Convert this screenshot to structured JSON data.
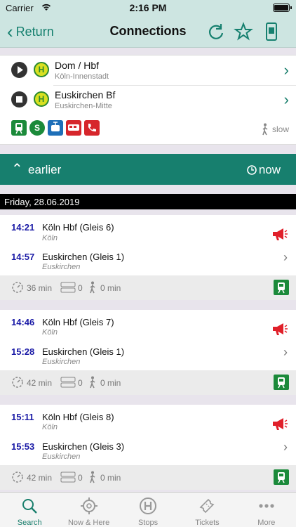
{
  "status": {
    "carrier": "Carrier",
    "time": "2:16 PM"
  },
  "nav": {
    "back_label": "Return",
    "title": "Connections"
  },
  "request": {
    "origin": {
      "name": "Dom / Hbf",
      "sub": "Köln-Innenstadt"
    },
    "destination": {
      "name": "Euskirchen Bf",
      "sub": "Euskirchen-Mitte"
    },
    "transport_modes": [
      "regional-train-icon",
      "s-bahn-icon",
      "tram-icon",
      "bus-icon",
      "phone-taxi-icon"
    ],
    "walk_speed": "slow"
  },
  "earlier": {
    "label": "earlier",
    "now_label": "now"
  },
  "date_header": "Friday, 28.06.2019",
  "connections": [
    {
      "dep_time": "14:21",
      "dep_station": "Köln Hbf (Gleis 6)",
      "dep_city": "Köln",
      "arr_time": "14:57",
      "arr_station": "Euskirchen (Gleis 1)",
      "arr_city": "Euskirchen",
      "duration": "36 min",
      "changes": "0",
      "walk": "0 min"
    },
    {
      "dep_time": "14:46",
      "dep_station": "Köln Hbf (Gleis 7)",
      "dep_city": "Köln",
      "arr_time": "15:28",
      "arr_station": "Euskirchen (Gleis 1)",
      "arr_city": "Euskirchen",
      "duration": "42 min",
      "changes": "0",
      "walk": "0 min"
    },
    {
      "dep_time": "15:11",
      "dep_station": "Köln Hbf (Gleis 8)",
      "dep_city": "Köln",
      "arr_time": "15:53",
      "arr_station": "Euskirchen (Gleis 3)",
      "arr_city": "Euskirchen",
      "duration": "42 min",
      "changes": "0",
      "walk": "0 min"
    }
  ],
  "tabs": [
    {
      "label": "Search",
      "icon": "search-icon",
      "active": true
    },
    {
      "label": "Now & Here",
      "icon": "crosshair-icon",
      "active": false
    },
    {
      "label": "Stops",
      "icon": "stop-icon",
      "active": false
    },
    {
      "label": "Tickets",
      "icon": "ticket-icon",
      "active": false
    },
    {
      "label": "More",
      "icon": "more-icon",
      "active": false
    }
  ],
  "colors": {
    "accent": "#177f6e",
    "navbar": "#cde5e1",
    "time_blue": "#1a1aa6",
    "alert_red": "#e0202a",
    "train_green": "#1b8a3a"
  }
}
